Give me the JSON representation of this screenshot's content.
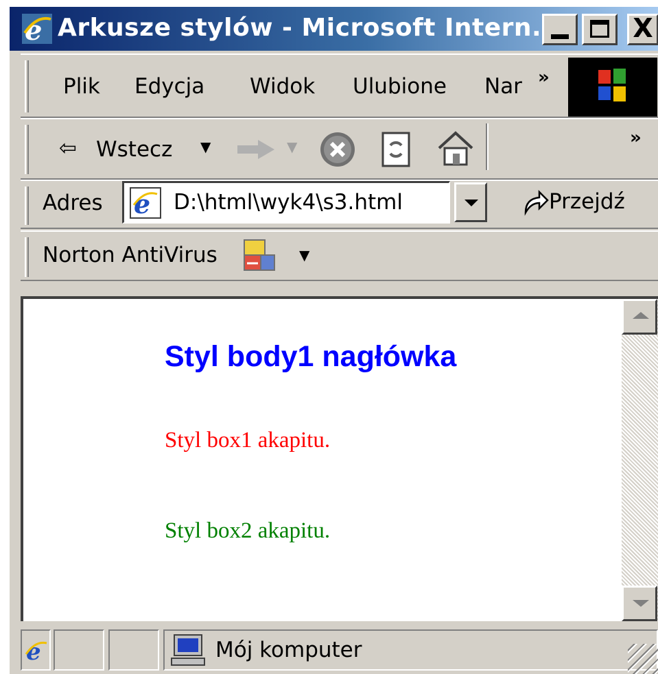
{
  "window": {
    "title": "Arkusze stylów - Microsoft Intern...",
    "title_bar_color": "#0a246a",
    "close_glyph": "X"
  },
  "menu": {
    "items": [
      {
        "label": "Plik"
      },
      {
        "label": "Edycja"
      },
      {
        "label": "Widok"
      },
      {
        "label": "Ulubione"
      },
      {
        "label": "Nar"
      }
    ],
    "overflow_chevron": "»"
  },
  "toolbar": {
    "back_label": "Wstecz",
    "back_arrow": "⇦",
    "overflow_chevron": "»"
  },
  "address": {
    "label": "Adres",
    "value": "D:\\html\\wyk4\\s3.html",
    "go_label": "Przejdź"
  },
  "norton": {
    "label": "Norton AntiVirus"
  },
  "page": {
    "heading": "Styl body1 nagłówka",
    "heading_color": "#0000ff",
    "para1": "Styl box1 akapitu.",
    "para1_color": "#ff0000",
    "para2": "Styl box2 akapitu.",
    "para2_color": "#008000"
  },
  "status": {
    "zone_text": "Mój komputer"
  },
  "icons": [
    "ie-icon",
    "windows-logo-icon",
    "back-arrow-icon",
    "forward-arrow-icon",
    "stop-icon",
    "refresh-icon",
    "home-icon",
    "go-arrow-icon",
    "norton-icon",
    "computer-icon"
  ]
}
